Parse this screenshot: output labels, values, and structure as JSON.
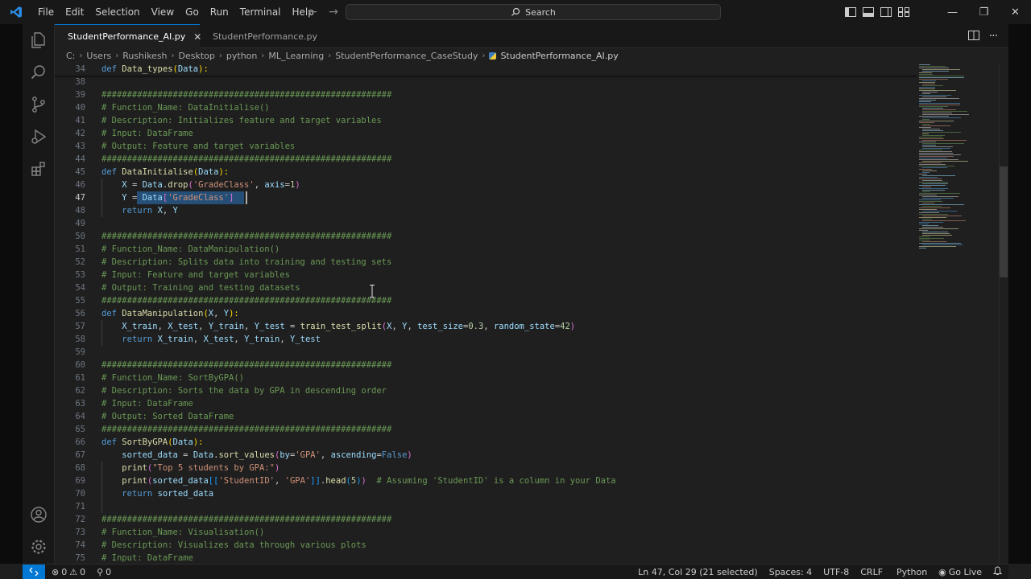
{
  "window": {
    "menu": [
      "File",
      "Edit",
      "Selection",
      "View",
      "Go",
      "Run",
      "Terminal",
      "Help"
    ],
    "search_label": "Search"
  },
  "tabs": [
    {
      "label": "StudentPerformance_AI.py",
      "active": true
    },
    {
      "label": "StudentPerformance.py",
      "active": false
    }
  ],
  "breadcrumb": [
    "C:",
    "Users",
    "Rushikesh",
    "Desktop",
    "python",
    "ML_Learning",
    "StudentPerformance_CaseStudy",
    "StudentPerformance_AI.py"
  ],
  "editor": {
    "current_line": 47,
    "lines": [
      {
        "n": 34,
        "t": [
          [
            "kw",
            "def "
          ],
          [
            "fn",
            "Data_types"
          ],
          [
            "yb",
            "("
          ],
          [
            "vr",
            "Data"
          ],
          [
            "yb",
            "):"
          ]
        ]
      },
      {
        "n": 38,
        "t": []
      },
      {
        "n": 39,
        "t": [
          [
            "cm",
            "#########################################################"
          ]
        ]
      },
      {
        "n": 40,
        "t": [
          [
            "cm",
            "# Function_Name: DataInitialise()"
          ]
        ]
      },
      {
        "n": 41,
        "t": [
          [
            "cm",
            "# Description: Initializes feature and target variables"
          ]
        ]
      },
      {
        "n": 42,
        "t": [
          [
            "cm",
            "# Input: DataFrame"
          ]
        ]
      },
      {
        "n": 43,
        "t": [
          [
            "cm",
            "# Output: Feature and target variables"
          ]
        ]
      },
      {
        "n": 44,
        "t": [
          [
            "cm",
            "#########################################################"
          ]
        ]
      },
      {
        "n": 45,
        "t": [
          [
            "kw",
            "def "
          ],
          [
            "fn",
            "DataInitialise"
          ],
          [
            "yb",
            "("
          ],
          [
            "vr",
            "Data"
          ],
          [
            "yb",
            "):"
          ]
        ]
      },
      {
        "n": 46,
        "t": [
          [
            "pl",
            "    "
          ],
          [
            "vr",
            "X"
          ],
          [
            "pl",
            " = "
          ],
          [
            "vr",
            "Data"
          ],
          [
            "pl",
            "."
          ],
          [
            "fn",
            "drop"
          ],
          [
            "bk",
            "("
          ],
          [
            "st",
            "'GradeClass'"
          ],
          [
            "pl",
            ", "
          ],
          [
            "vr",
            "axis"
          ],
          [
            "pl",
            "="
          ],
          [
            "nm",
            "1"
          ],
          [
            "bk",
            ")"
          ]
        ]
      },
      {
        "n": 47,
        "t": [
          [
            "pl",
            "    "
          ],
          [
            "vr",
            "Y"
          ],
          [
            "pl",
            " = "
          ],
          [
            "vr",
            "Data"
          ],
          [
            "bk",
            "["
          ],
          [
            "st",
            "'GradeClass'"
          ],
          [
            "bk",
            "]"
          ]
        ]
      },
      {
        "n": 48,
        "t": [
          [
            "pl",
            "    "
          ],
          [
            "kw",
            "return "
          ],
          [
            "vr",
            "X"
          ],
          [
            "pl",
            ", "
          ],
          [
            "vr",
            "Y"
          ]
        ]
      },
      {
        "n": 49,
        "t": []
      },
      {
        "n": 50,
        "t": [
          [
            "cm",
            "#########################################################"
          ]
        ]
      },
      {
        "n": 51,
        "t": [
          [
            "cm",
            "# Function_Name: DataManipulation()"
          ]
        ]
      },
      {
        "n": 52,
        "t": [
          [
            "cm",
            "# Description: Splits data into training and testing sets"
          ]
        ]
      },
      {
        "n": 53,
        "t": [
          [
            "cm",
            "# Input: Feature and target variables"
          ]
        ]
      },
      {
        "n": 54,
        "t": [
          [
            "cm",
            "# Output: Training and testing datasets"
          ]
        ]
      },
      {
        "n": 55,
        "t": [
          [
            "cm",
            "#########################################################"
          ]
        ]
      },
      {
        "n": 56,
        "t": [
          [
            "kw",
            "def "
          ],
          [
            "fn",
            "DataManipulation"
          ],
          [
            "yb",
            "("
          ],
          [
            "vr",
            "X"
          ],
          [
            "pl",
            ", "
          ],
          [
            "vr",
            "Y"
          ],
          [
            "yb",
            "):"
          ]
        ]
      },
      {
        "n": 57,
        "t": [
          [
            "pl",
            "    "
          ],
          [
            "vr",
            "X_train"
          ],
          [
            "pl",
            ", "
          ],
          [
            "vr",
            "X_test"
          ],
          [
            "pl",
            ", "
          ],
          [
            "vr",
            "Y_train"
          ],
          [
            "pl",
            ", "
          ],
          [
            "vr",
            "Y_test"
          ],
          [
            "pl",
            " = "
          ],
          [
            "fn",
            "train_test_split"
          ],
          [
            "bk",
            "("
          ],
          [
            "vr",
            "X"
          ],
          [
            "pl",
            ", "
          ],
          [
            "vr",
            "Y"
          ],
          [
            "pl",
            ", "
          ],
          [
            "vr",
            "test_size"
          ],
          [
            "pl",
            "="
          ],
          [
            "nm",
            "0.3"
          ],
          [
            "pl",
            ", "
          ],
          [
            "vr",
            "random_state"
          ],
          [
            "pl",
            "="
          ],
          [
            "nm",
            "42"
          ],
          [
            "bk",
            ")"
          ]
        ]
      },
      {
        "n": 58,
        "t": [
          [
            "pl",
            "    "
          ],
          [
            "kw",
            "return "
          ],
          [
            "vr",
            "X_train"
          ],
          [
            "pl",
            ", "
          ],
          [
            "vr",
            "X_test"
          ],
          [
            "pl",
            ", "
          ],
          [
            "vr",
            "Y_train"
          ],
          [
            "pl",
            ", "
          ],
          [
            "vr",
            "Y_test"
          ]
        ]
      },
      {
        "n": 59,
        "t": []
      },
      {
        "n": 60,
        "t": [
          [
            "cm",
            "#########################################################"
          ]
        ]
      },
      {
        "n": 61,
        "t": [
          [
            "cm",
            "# Function_Name: SortByGPA()"
          ]
        ]
      },
      {
        "n": 62,
        "t": [
          [
            "cm",
            "# Description: Sorts the data by GPA in descending order"
          ]
        ]
      },
      {
        "n": 63,
        "t": [
          [
            "cm",
            "# Input: DataFrame"
          ]
        ]
      },
      {
        "n": 64,
        "t": [
          [
            "cm",
            "# Output: Sorted DataFrame"
          ]
        ]
      },
      {
        "n": 65,
        "t": [
          [
            "cm",
            "#########################################################"
          ]
        ]
      },
      {
        "n": 66,
        "t": [
          [
            "kw",
            "def "
          ],
          [
            "fn",
            "SortByGPA"
          ],
          [
            "yb",
            "("
          ],
          [
            "vr",
            "Data"
          ],
          [
            "yb",
            "):"
          ]
        ]
      },
      {
        "n": 67,
        "t": [
          [
            "pl",
            "    "
          ],
          [
            "vr",
            "sorted_data"
          ],
          [
            "pl",
            " = "
          ],
          [
            "vr",
            "Data"
          ],
          [
            "pl",
            "."
          ],
          [
            "fn",
            "sort_values"
          ],
          [
            "bk",
            "("
          ],
          [
            "vr",
            "by"
          ],
          [
            "pl",
            "="
          ],
          [
            "st",
            "'GPA'"
          ],
          [
            "pl",
            ", "
          ],
          [
            "vr",
            "ascending"
          ],
          [
            "pl",
            "="
          ],
          [
            "kw",
            "False"
          ],
          [
            "bk",
            ")"
          ]
        ]
      },
      {
        "n": 68,
        "t": [
          [
            "pl",
            "    "
          ],
          [
            "fn",
            "print"
          ],
          [
            "bk",
            "("
          ],
          [
            "st",
            "\"Top 5 students by GPA:\""
          ],
          [
            "bk",
            ")"
          ]
        ]
      },
      {
        "n": 69,
        "t": [
          [
            "pl",
            "    "
          ],
          [
            "fn",
            "print"
          ],
          [
            "bk",
            "("
          ],
          [
            "vr",
            "sorted_data"
          ],
          [
            "bk2",
            "[["
          ],
          [
            "st",
            "'StudentID'"
          ],
          [
            "pl",
            ", "
          ],
          [
            "st",
            "'GPA'"
          ],
          [
            "bk2",
            "]]"
          ],
          [
            "pl",
            "."
          ],
          [
            "fn",
            "head"
          ],
          [
            "bk2",
            "("
          ],
          [
            "nm",
            "5"
          ],
          [
            "bk2",
            ")"
          ],
          [
            "bk",
            ")"
          ],
          [
            "pl",
            "  "
          ],
          [
            "cm",
            "# Assuming 'StudentID' is a column in your Data"
          ]
        ]
      },
      {
        "n": 70,
        "t": [
          [
            "pl",
            "    "
          ],
          [
            "kw",
            "return "
          ],
          [
            "vr",
            "sorted_data"
          ]
        ]
      },
      {
        "n": 71,
        "t": []
      },
      {
        "n": 72,
        "t": [
          [
            "cm",
            "#########################################################"
          ]
        ]
      },
      {
        "n": 73,
        "t": [
          [
            "cm",
            "# Function_Name: Visualisation()"
          ]
        ]
      },
      {
        "n": 74,
        "t": [
          [
            "cm",
            "# Description: Visualizes data through various plots"
          ]
        ]
      },
      {
        "n": 75,
        "t": [
          [
            "cm",
            "# Input: DataFrame"
          ]
        ]
      }
    ]
  },
  "statusbar": {
    "errors": "0",
    "warnings": "0",
    "ports": "0",
    "position": "Ln 47, Col 29 (21 selected)",
    "spaces": "Spaces: 4",
    "encoding": "UTF-8",
    "eol": "CRLF",
    "language": "Python",
    "golive": "Go Live"
  },
  "colors": {
    "accent": "#0078d4",
    "selection": "#264f78"
  }
}
